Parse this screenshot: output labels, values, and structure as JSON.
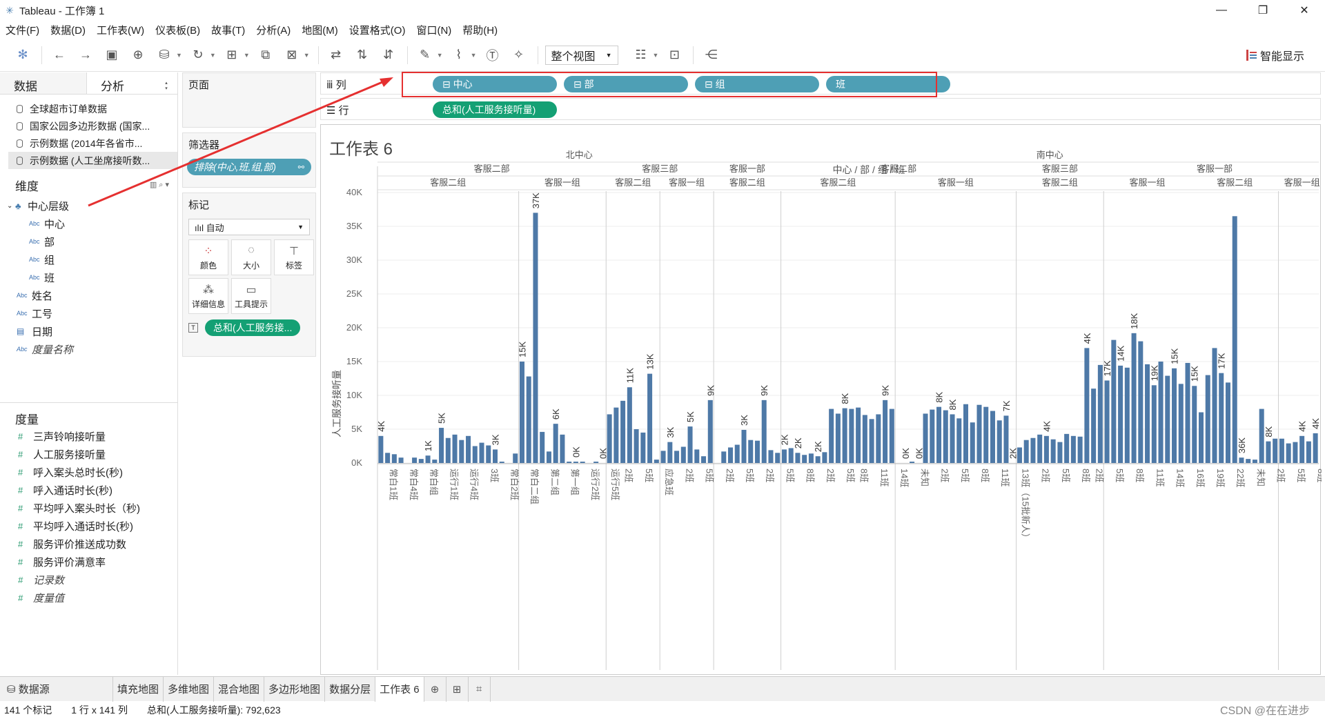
{
  "window": {
    "title": "Tableau - 工作簿 1"
  },
  "menu": [
    "文件(F)",
    "数据(D)",
    "工作表(W)",
    "仪表板(B)",
    "故事(T)",
    "分析(A)",
    "地图(M)",
    "设置格式(O)",
    "窗口(N)",
    "帮助(H)"
  ],
  "toolbar": {
    "view_select": "整个视图",
    "smart_show": "智能显示"
  },
  "data_pane": {
    "tabs": [
      "数据",
      "分析"
    ],
    "datasources": [
      "全球超市订单数据",
      "国家公园多边形数据 (国家...",
      "示例数据 (2014年各省市...",
      "示例数据 (人工坐席接听数..."
    ],
    "dimensions_title": "维度",
    "hierarchy": "中心层级",
    "hierarchy_fields": [
      "中心",
      "部",
      "组",
      "班"
    ],
    "dimensions": [
      "姓名",
      "工号",
      "日期"
    ],
    "dimension_italic": "度量名称",
    "measures_title": "度量",
    "measures": [
      "三声铃响接听量",
      "人工服务接听量",
      "呼入案头总时长(秒)",
      "呼入通话时长(秒)",
      "平均呼入案头时长（秒)",
      "平均呼入通话时长(秒)",
      "服务评价推送成功数",
      "服务评价满意率"
    ],
    "measures_italic": [
      "记录数",
      "度量值"
    ],
    "type_abc": "Abc"
  },
  "shelves": {
    "pages": "页面",
    "filters": "筛选器",
    "filter_pill": "排除(中心,班,组,部)",
    "marks": "标记",
    "marks_type": "自动",
    "mark_buttons": [
      "颜色",
      "大小",
      "标签",
      "详细信息",
      "工具提示"
    ],
    "marks_pill": "总和(人工服务接...",
    "columns_label": "列",
    "rows_label": "行",
    "column_pills": [
      "中心",
      "部",
      "组",
      "班"
    ],
    "row_pill": "总和(人工服务接听量)"
  },
  "sheet": {
    "title": "工作表 6",
    "header_path": "中心 / 部 / 组 / 班",
    "y_axis_title": "人工服务接听量"
  },
  "chart_data": {
    "type": "bar",
    "ylabel": "人工服务接听量",
    "ylim": [
      0,
      40000
    ],
    "y_ticks": [
      "0K",
      "5K",
      "10K",
      "15K",
      "20K",
      "25K",
      "30K",
      "35K",
      "40K"
    ],
    "centers": [
      "北中心",
      "南中心"
    ],
    "departments": [
      "客服二部",
      "客服三部",
      "客服一部",
      "客服二部",
      "客服三部",
      "客服一部"
    ],
    "groups": [
      "客服二组",
      "客服一组",
      "客服二组",
      "客服一组",
      "客服二组",
      "客服二组",
      "客服一组",
      "客服二组",
      "客服一组",
      "客服二组",
      "客服一组"
    ],
    "category_tick_labels": [
      "常白1班",
      "常白4班",
      "常白组",
      "运行1班",
      "运行4班",
      "3班",
      "常白2班",
      "常白二组",
      "第二组",
      "第一组",
      "运行2班",
      "运行5班",
      "2班",
      "5班",
      "应急班",
      "2班",
      "5班",
      "2班",
      "5班",
      "2班",
      "5班",
      "8班",
      "2班",
      "5班",
      "8班",
      "11班",
      "14班",
      "未知",
      "2班",
      "5班",
      "8班",
      "11班",
      "13班（15批新人）",
      "2班",
      "5班",
      "8班",
      "2班",
      "5班",
      "8班",
      "11班",
      "14班",
      "16班",
      "19班",
      "22班",
      "未知",
      "2班",
      "5班",
      "8班"
    ],
    "data_labels": [
      "4K",
      "1K",
      "5K",
      "3K",
      "15K",
      "37K",
      "6K",
      "0K",
      "0K",
      "11K",
      "13K",
      "3K",
      "5K",
      "9K",
      "3K",
      "9K",
      "2K",
      "2K",
      "2K",
      "8K",
      "9K",
      "0K",
      "0K",
      "8K",
      "8K",
      "7K",
      "2K",
      "4K",
      "4K",
      "17K",
      "14K",
      "18K",
      "19K",
      "15K",
      "15K",
      "17K",
      "36K",
      "8K",
      "4K",
      "4K"
    ],
    "values": [
      4000,
      1500,
      1300,
      800,
      0,
      800,
      600,
      1100,
      500,
      5200,
      3700,
      4200,
      3400,
      4000,
      2500,
      3000,
      2600,
      2000,
      200,
      0,
      1400,
      15000,
      12800,
      37000,
      4600,
      1700,
      5800,
      4200,
      200,
      200,
      200,
      0,
      200,
      0,
      7200,
      8200,
      9200,
      11200,
      5000,
      4500,
      13200,
      500,
      1800,
      3100,
      1800,
      2400,
      5400,
      2000,
      1000,
      9300,
      0,
      1700,
      2300,
      2700,
      4900,
      3400,
      3300,
      9300,
      1900,
      1500,
      2000,
      2200,
      1500,
      1200,
      1400,
      1000,
      1600,
      8000,
      7300,
      8100,
      8000,
      8200,
      7100,
      6500,
      7200,
      9300,
      8000,
      0,
      0,
      200,
      0,
      7300,
      7900,
      8300,
      7800,
      7200,
      6600,
      8700,
      6000,
      8600,
      8300,
      7700,
      6300,
      7000,
      0,
      2300,
      3400,
      3700,
      4200,
      4000,
      3500,
      3100,
      4300,
      4000,
      3900,
      17000,
      11000,
      14500,
      12200,
      18200,
      14400,
      14100,
      19200,
      18000,
      14600,
      11500,
      15000,
      12900,
      14000,
      11700,
      14800,
      11400,
      7500,
      13000,
      17000,
      13300,
      11900,
      36500,
      800,
      600,
      500,
      8000,
      3200,
      3600,
      3600,
      2900,
      3100,
      4000,
      3200,
      4400
    ]
  },
  "tabs": [
    "数据源",
    "填充地图",
    "多维地图",
    "混合地图",
    "多边形地图",
    "数据分层",
    "工作表 6"
  ],
  "status": {
    "marks": "141 个标记",
    "rows_cols": "1 行 x 141 列",
    "sum": "总和(人工服务接听量): 792,623"
  },
  "watermark": "CSDN @在在进步"
}
